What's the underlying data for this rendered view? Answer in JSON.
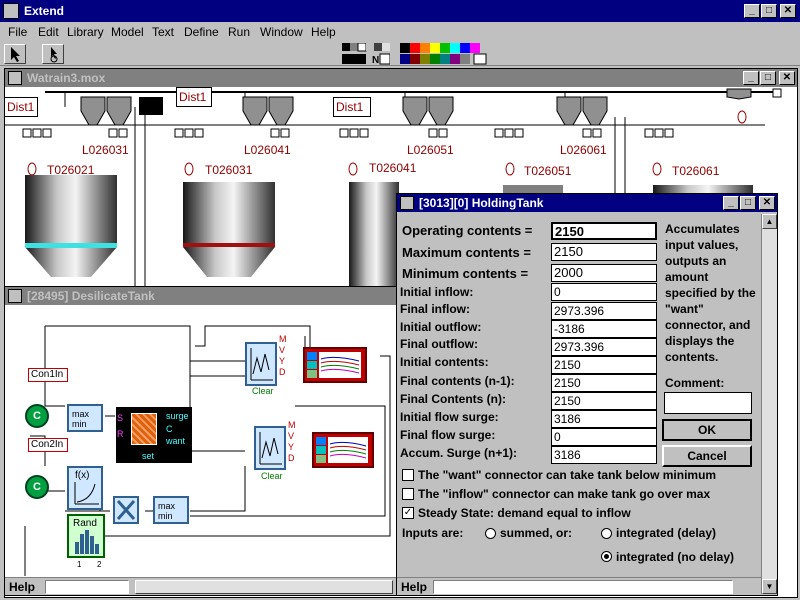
{
  "app": {
    "title": "Extend"
  },
  "menu": [
    "File",
    "Edit",
    "Library",
    "Model",
    "Text",
    "Define",
    "Run",
    "Window",
    "Help"
  ],
  "model_window": {
    "title": "Watrain3.mox",
    "dist_labels": [
      "Dist1",
      "Dist1",
      "Dist1"
    ],
    "line_labels": [
      "L026031",
      "L026041",
      "L026051",
      "L026061"
    ],
    "tank_labels": [
      "T026021",
      "T026031",
      "T026041",
      "T026051",
      "T026061"
    ],
    "circle_label": "O"
  },
  "desilicate_window": {
    "title": "[28495]   DesilicateTank",
    "help": "Help",
    "con1": "Con1In",
    "con2": "Con2In",
    "c_label": "C",
    "maxmin": "max\nmin",
    "tank_ports": {
      "surge": "surge",
      "c": "C",
      "want": "want",
      "set": "set",
      "r": "R",
      "s": "S"
    },
    "plot_ports": [
      "M",
      "V",
      "Y",
      "D",
      "Y"
    ],
    "clear": "Clear",
    "fx": "f(x)",
    "rand": "Rand",
    "port_nums": [
      "1",
      "2"
    ]
  },
  "dialog": {
    "title": "[3013][0]   HoldingTank",
    "rows": [
      {
        "label": "Operating contents =",
        "value": "2150"
      },
      {
        "label": "Maximum contents =",
        "value": "2150"
      },
      {
        "label": "Minimum contents =",
        "value": "2000"
      },
      {
        "label": "Initial inflow:",
        "value": "0"
      },
      {
        "label": "Final inflow:",
        "value": "2973.396"
      },
      {
        "label": "Initial outflow:",
        "value": "-3186"
      },
      {
        "label": "Final outflow:",
        "value": "2973.396"
      },
      {
        "label": "Initial contents:",
        "value": "2150"
      },
      {
        "label": "Final contents (n-1):",
        "value": "2150"
      },
      {
        "label": "Final Contents (n):",
        "value": "2150"
      },
      {
        "label": "Initial flow surge:",
        "value": "3186"
      },
      {
        "label": "Final flow surge:",
        "value": "0"
      },
      {
        "label": "Accum. Surge (n+1):",
        "value": "3186"
      }
    ],
    "description": "Accumulates input values, outputs an amount specified by the \"want\" connector, and displays the contents.",
    "comment_label": "Comment:",
    "comment_value": "",
    "ok": "OK",
    "cancel": "Cancel",
    "checkboxes": [
      {
        "label": "The \"want\" connector can take tank below minimum",
        "checked": false
      },
      {
        "label": "The \"inflow\" connector can make tank go over max",
        "checked": false
      },
      {
        "label": "Steady State: demand equal to inflow",
        "checked": true
      }
    ],
    "inputs_label": "Inputs are:",
    "radios": [
      {
        "label": "summed, or:",
        "selected": false
      },
      {
        "label": "integrated (delay)",
        "selected": false
      },
      {
        "label": "integrated (no delay)",
        "selected": true
      }
    ],
    "help": "Help"
  },
  "colors": {
    "titlebar_active": "#000080",
    "titlebar_inactive": "#808080",
    "label_red": "#900000"
  }
}
